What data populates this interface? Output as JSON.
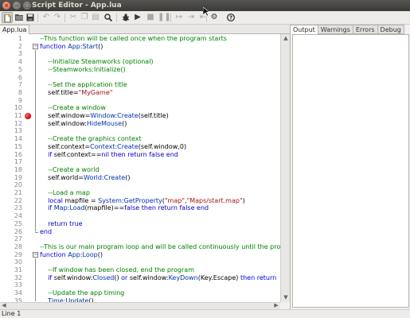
{
  "window": {
    "title": "Script Editor - App.lua",
    "close_glyph": "×",
    "min_glyph": "−",
    "max_glyph": "□"
  },
  "toolbar": {
    "icons": [
      "new-file-icon",
      "open-folder-icon",
      "save-icon",
      "undo-icon",
      "redo-icon",
      "cut-icon",
      "copy-icon",
      "paste-icon",
      "find-icon",
      "debug-bug-icon",
      "run-icon",
      "stop-icon",
      "pause-icon",
      "step-over-icon",
      "step-in-icon",
      "step-out-icon",
      "settings-gear-icon",
      "help-icon"
    ]
  },
  "editor": {
    "tab_label": "App.lua",
    "breakpoint_line": 11
  },
  "right_panel": {
    "tabs": [
      "Output",
      "Warnings",
      "Errors",
      "Debug"
    ],
    "active_tab": "Output"
  },
  "status": {
    "text": "Line 1"
  },
  "code": [
    {
      "n": "1",
      "t": [
        {
          "c": "c",
          "v": "--This function will be called once when the program starts"
        }
      ]
    },
    {
      "n": "2",
      "t": [
        {
          "c": "k",
          "v": "function "
        },
        {
          "c": "f",
          "v": "App:Start"
        },
        {
          "c": "",
          "v": "()"
        }
      ]
    },
    {
      "n": "3",
      "t": []
    },
    {
      "n": "4",
      "t": [
        {
          "c": "c",
          "v": "    --Initialize Steamworks (optional)"
        }
      ]
    },
    {
      "n": "5",
      "t": [
        {
          "c": "c",
          "v": "    --Steamworks:Initialize()"
        }
      ]
    },
    {
      "n": "6",
      "t": []
    },
    {
      "n": "7",
      "t": [
        {
          "c": "c",
          "v": "    --Set the application title"
        }
      ]
    },
    {
      "n": "8",
      "t": [
        {
          "c": "",
          "v": "    self.title="
        },
        {
          "c": "s",
          "v": "\"MyGame\""
        }
      ]
    },
    {
      "n": "9",
      "t": []
    },
    {
      "n": "10",
      "t": [
        {
          "c": "c",
          "v": "    --Create a window"
        }
      ]
    },
    {
      "n": "11",
      "t": [
        {
          "c": "",
          "v": "    self.window="
        },
        {
          "c": "f",
          "v": "Window:Create"
        },
        {
          "c": "",
          "v": "(self.title)"
        }
      ]
    },
    {
      "n": "12",
      "t": [
        {
          "c": "",
          "v": "    self.window:"
        },
        {
          "c": "f",
          "v": "HideMouse"
        },
        {
          "c": "",
          "v": "()"
        }
      ]
    },
    {
      "n": "13",
      "t": []
    },
    {
      "n": "14",
      "t": [
        {
          "c": "c",
          "v": "    --Create the graphics context"
        }
      ]
    },
    {
      "n": "15",
      "t": [
        {
          "c": "",
          "v": "    self.context="
        },
        {
          "c": "f",
          "v": "Context:Create"
        },
        {
          "c": "",
          "v": "(self.window,0)"
        }
      ]
    },
    {
      "n": "16",
      "t": [
        {
          "c": "k",
          "v": "    if "
        },
        {
          "c": "",
          "v": "self.context=="
        },
        {
          "c": "k",
          "v": "nil then return false end"
        }
      ]
    },
    {
      "n": "17",
      "t": []
    },
    {
      "n": "18",
      "t": [
        {
          "c": "c",
          "v": "    --Create a world"
        }
      ]
    },
    {
      "n": "19",
      "t": [
        {
          "c": "",
          "v": "    self.world="
        },
        {
          "c": "f",
          "v": "World:Create"
        },
        {
          "c": "",
          "v": "()"
        }
      ]
    },
    {
      "n": "20",
      "t": []
    },
    {
      "n": "21",
      "t": [
        {
          "c": "c",
          "v": "    --Load a map"
        }
      ]
    },
    {
      "n": "22",
      "t": [
        {
          "c": "k",
          "v": "    local "
        },
        {
          "c": "",
          "v": "mapfile = "
        },
        {
          "c": "f",
          "v": "System:GetProperty"
        },
        {
          "c": "",
          "v": "("
        },
        {
          "c": "s",
          "v": "\"map\""
        },
        {
          "c": "",
          "v": ","
        },
        {
          "c": "s",
          "v": "\"Maps/start.map\""
        },
        {
          "c": "",
          "v": ")"
        }
      ]
    },
    {
      "n": "23",
      "t": [
        {
          "c": "k",
          "v": "    if "
        },
        {
          "c": "f",
          "v": "Map:Load"
        },
        {
          "c": "",
          "v": "(mapfile)=="
        },
        {
          "c": "k",
          "v": "false then return false end"
        }
      ]
    },
    {
      "n": "24",
      "t": []
    },
    {
      "n": "25",
      "t": [
        {
          "c": "k",
          "v": "    return true"
        }
      ]
    },
    {
      "n": "26",
      "t": [
        {
          "c": "k",
          "v": "end"
        }
      ]
    },
    {
      "n": "27",
      "t": []
    },
    {
      "n": "28",
      "t": [
        {
          "c": "c",
          "v": "--This is our main program loop and will be called continuously until the prog"
        }
      ]
    },
    {
      "n": "29",
      "t": [
        {
          "c": "k",
          "v": "function "
        },
        {
          "c": "f",
          "v": "App:Loop"
        },
        {
          "c": "",
          "v": "()"
        }
      ]
    },
    {
      "n": "30",
      "t": []
    },
    {
      "n": "31",
      "t": [
        {
          "c": "c",
          "v": "    --If window has been closed, end the program"
        }
      ]
    },
    {
      "n": "32",
      "t": [
        {
          "c": "k",
          "v": "    if "
        },
        {
          "c": "",
          "v": "self.window:"
        },
        {
          "c": "f",
          "v": "Closed"
        },
        {
          "c": "",
          "v": "() "
        },
        {
          "c": "k",
          "v": "or "
        },
        {
          "c": "",
          "v": "self.window:"
        },
        {
          "c": "f",
          "v": "KeyDown"
        },
        {
          "c": "",
          "v": "(Key.Escape) "
        },
        {
          "c": "k",
          "v": "then return"
        }
      ]
    },
    {
      "n": "33",
      "t": []
    },
    {
      "n": "34",
      "t": [
        {
          "c": "c",
          "v": "    --Update the app timing"
        }
      ]
    },
    {
      "n": "35",
      "t": [
        {
          "c": "",
          "v": "    "
        },
        {
          "c": "f",
          "v": "Time:Update"
        },
        {
          "c": "",
          "v": "()"
        }
      ]
    }
  ]
}
